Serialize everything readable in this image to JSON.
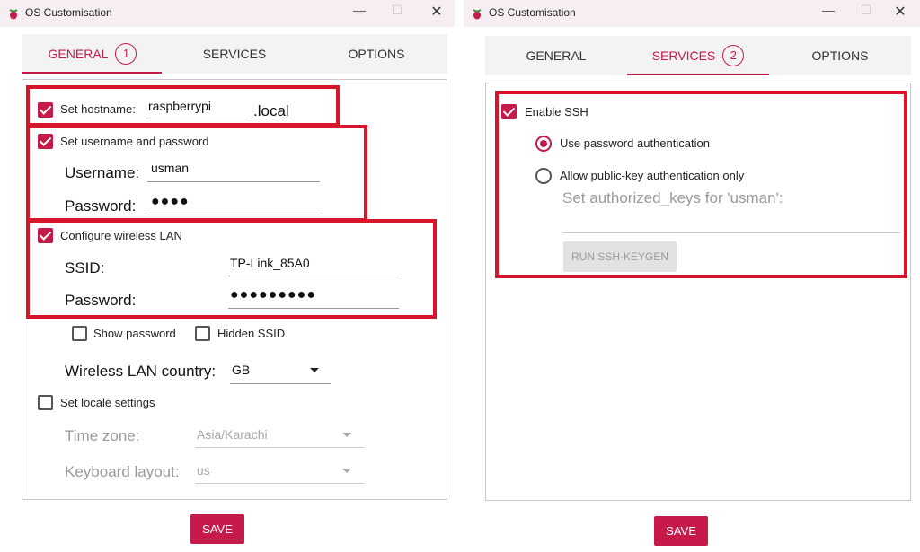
{
  "window_general": {
    "title": "OS Customisation",
    "controls": {
      "minimize": "—",
      "maximize": "☐",
      "close": "✕"
    },
    "tabs": [
      {
        "label": "GENERAL",
        "badge": "1"
      },
      {
        "label": "SERVICES"
      },
      {
        "label": "OPTIONS"
      }
    ],
    "hostname": {
      "label": "Set hostname:",
      "value": "raspberrypi",
      "suffix": ".local"
    },
    "user": {
      "label": "Set username and password",
      "username_label": "Username:",
      "username_value": "usman",
      "password_label": "Password:",
      "password_value": "●●●●"
    },
    "wlan": {
      "label": "Configure wireless LAN",
      "ssid_label": "SSID:",
      "ssid_value": "TP-Link_85A0",
      "password_label": "Password:",
      "password_value": "●●●●●●●●●"
    },
    "show_password": "Show password",
    "hidden_ssid": "Hidden SSID",
    "country": {
      "label": "Wireless LAN country:",
      "value": "GB"
    },
    "locale": {
      "label": "Set locale settings",
      "timezone_label": "Time zone:",
      "timezone_value": "Asia/Karachi",
      "keyboard_label": "Keyboard layout:",
      "keyboard_value": "us"
    },
    "save_label": "SAVE"
  },
  "window_services": {
    "title": "OS Customisation",
    "controls": {
      "minimize": "—",
      "maximize": "☐",
      "close": "✕"
    },
    "tabs": [
      {
        "label": "GENERAL"
      },
      {
        "label": "SERVICES",
        "badge": "2"
      },
      {
        "label": "OPTIONS"
      }
    ],
    "enable_ssh": "Enable SSH",
    "use_password": "Use password authentication",
    "public_key": "Allow public-key authentication only",
    "authorized_keys_label": "Set authorized_keys for 'usman':",
    "keygen_label": "RUN SSH-KEYGEN",
    "save_label": "SAVE"
  },
  "colors": {
    "accent": "#c51a4a",
    "highlight": "#d7162c"
  }
}
